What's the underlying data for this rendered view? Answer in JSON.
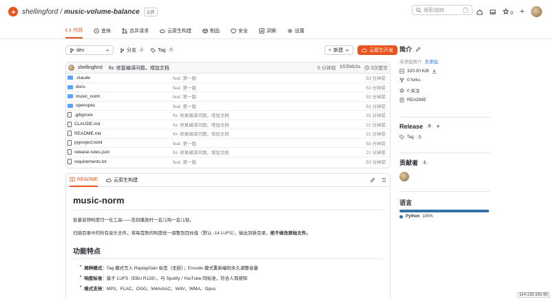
{
  "header": {
    "owner": "shellingford",
    "repo": "music-volume-balance",
    "visibility": "公开",
    "search_placeholder": "搜索/跳转",
    "search_key": "/",
    "star_count": "0"
  },
  "tabs": [
    {
      "label": "代码",
      "icon": "code-icon"
    },
    {
      "label": "宜休",
      "icon": "issue-icon"
    },
    {
      "label": "合并请求",
      "icon": "pr-icon"
    },
    {
      "label": "云原生构建",
      "icon": "cloud-icon"
    },
    {
      "label": "制品",
      "icon": "package-icon"
    },
    {
      "label": "安全",
      "icon": "shield-icon"
    },
    {
      "label": "洞察",
      "icon": "chart-icon"
    },
    {
      "label": "设置",
      "icon": "gear-icon"
    }
  ],
  "toolbar": {
    "branch": "dev",
    "branch_label": "分支",
    "branch_count": "2",
    "tag_label": "Tag",
    "tag_count": "0",
    "new_label": "新建",
    "dev_label": "云原生开发"
  },
  "commit": {
    "author": "shellingford",
    "message": "fix: 修复编译问题，增加文档",
    "time": "5 分钟前",
    "hash": "b53fab3a",
    "count": "3次提交"
  },
  "files": [
    {
      "name": ".claude",
      "type": "dir",
      "msg": "feat: 第一版",
      "time": "53 分钟前"
    },
    {
      "name": "docs",
      "type": "dir",
      "msg": "feat: 第一版",
      "time": "53 分钟前"
    },
    {
      "name": "music_norm",
      "type": "dir",
      "msg": "feat: 第一版",
      "time": "53 分钟前"
    },
    {
      "name": "openspec",
      "type": "dir",
      "msg": "feat: 第一版",
      "time": "53 分钟前"
    },
    {
      "name": ".gitignore",
      "type": "file",
      "msg": "fix: 修复编译问题，增加文档",
      "time": "31 分钟前"
    },
    {
      "name": "CLAUDE.md",
      "type": "file",
      "msg": "fix: 修复编译问题，增加文档",
      "time": "21 分钟前"
    },
    {
      "name": "README.md",
      "type": "file",
      "msg": "fix: 修复编译问题，增加文档",
      "time": "21 分钟前"
    },
    {
      "name": "pyproject.toml",
      "type": "file",
      "msg": "feat: 第一版",
      "time": "53 分钟前"
    },
    {
      "name": "release-rules.json",
      "type": "file",
      "msg": "fix: 修复编译问题，增加文档",
      "time": "21 分钟前"
    },
    {
      "name": "requirements.txt",
      "type": "file",
      "msg": "feat: 第一版",
      "time": "53 分钟前"
    }
  ],
  "readme": {
    "tab1": "README",
    "tab2": "云原生构建",
    "title": "music-norm",
    "p1": "批量音频响度归一化工具——告别播放时一会儿响一会儿轻。",
    "p2a": "扫描目录中的所有音乐文件，将每首歌的响度统一调整到目标值（默认 -14 LUFS），输出到新目录，",
    "p2b": "绝不修改原始文件。",
    "h2": "功能特点",
    "features": [
      {
        "k": "两种模式",
        "v": "：Tag 模式写入 ReplayGain 标签（无损）；Encode 模式重新编码永久调整音量"
      },
      {
        "k": "响度标准",
        "v": "：基于 LUFS（EBU R128），与 Spotify / YouTube 同标准，符合人耳感知"
      },
      {
        "k": "格式支持",
        "v": "：MP3、FLAC、OGG、M4A/AAC、WAV、WMA、Opus"
      }
    ]
  },
  "sidebar": {
    "intro_title": "简介",
    "intro_text": "未添加简介",
    "intro_link": "去添加",
    "size": "320.00 KiB",
    "forks": "0 forks",
    "watch": "0 关注",
    "readme": "README",
    "release_title": "Release",
    "release_count": "0",
    "tag_label": "Tag",
    "tag_count": "0",
    "contrib_title": "贡献者",
    "contrib_count": "1",
    "lang_title": "语言",
    "lang_name": "Python",
    "lang_pct": "100%"
  },
  "footer": {
    "ip": "114.132.192.93"
  }
}
